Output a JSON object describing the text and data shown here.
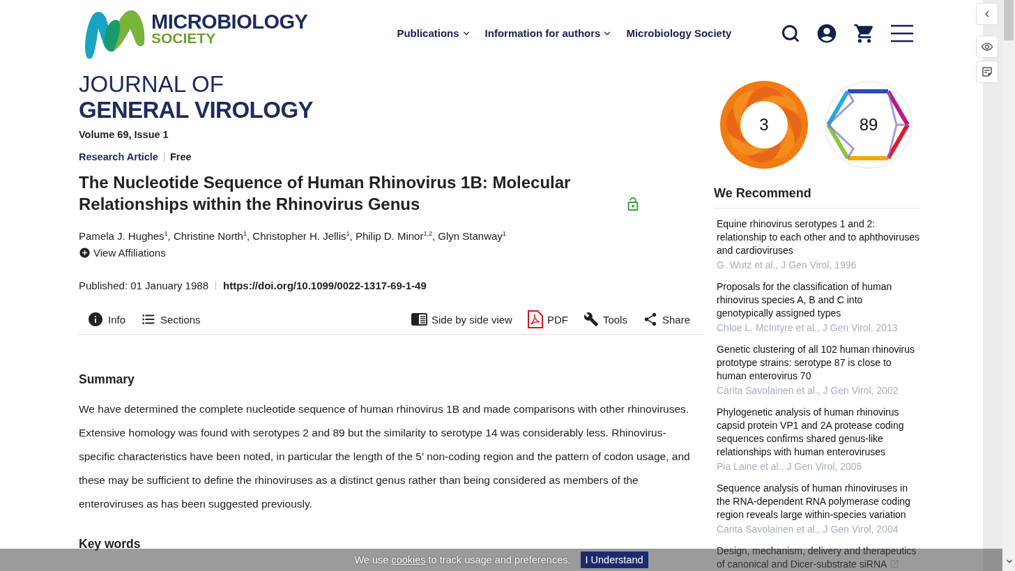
{
  "logo": {
    "line1": "MICROBIOLOGY",
    "line2": "SOCIETY"
  },
  "nav": [
    {
      "label": "Publications",
      "dropdown": true
    },
    {
      "label": "Information for authors",
      "dropdown": true
    },
    {
      "label": "Microbiology Society"
    }
  ],
  "journal": {
    "line1": "JOURNAL OF",
    "line2": "GENERAL VIROLOGY"
  },
  "issue": "Volume 69, Issue 1",
  "article_type": "Research Article",
  "access": "Free",
  "title": "The Nucleotide Sequence of Human Rhinovirus 1B: Molecular Relationships within the Rhinovirus Genus",
  "open_access": true,
  "authors": "Pamela J. Hughes$^{1}$, Christine North$^{1}$, Christopher H. Jellis$^{1}$, Philip D. Minor$^{1,2}$, Glyn Stanway$^{1}$",
  "view_affiliations": "View Affiliations",
  "published": "Published: 01 January 1988",
  "doi": "https://doi.org/10.1099/0022-1317-69-1-49",
  "toolbar_left": [
    {
      "kind": "info",
      "label": "Info"
    },
    {
      "kind": "sections",
      "label": "Sections"
    }
  ],
  "toolbar_right": [
    {
      "kind": "sidebyside",
      "label": "Side by side view"
    },
    {
      "kind": "pdf",
      "label": "PDF"
    },
    {
      "kind": "tools",
      "label": "Tools"
    },
    {
      "kind": "share",
      "label": "Share"
    }
  ],
  "summary": {
    "heading": "Summary",
    "text": "We have determined the complete nucleotide sequence of human rhinovirus 1B and made comparisons with other rhinoviruses. Extensive homology was found with serotypes 2 and 89 but the similarity to serotype 14 was considerably less. Rhinovirus-specific characteristics have been noted, in particular the length of the 5′ non-coding region and the pattern of codon usage, and these may be sufficient to define the rhinoviruses as a distinct genus rather than being considered as members of the enteroviruses as has been suggested previously."
  },
  "keywords": {
    "heading": "Key words"
  },
  "metrics": [
    {
      "kind": "altmetric",
      "value": "3"
    },
    {
      "kind": "dimensions",
      "value": "89"
    }
  ],
  "recommend": {
    "heading": "We Recommend",
    "items": [
      {
        "title": "Equine rhinovirus serotypes 1 and 2: relationship to each other and to aphthoviruses and cardioviruses",
        "meta": "G. Wutz et al., J Gen Virol, 1996"
      },
      {
        "title": "Proposals for the classification of human rhinovirus species A, B and C into genotypically assigned types",
        "meta": "Chloe L. McIntyre et al., J Gen Virol, 2013"
      },
      {
        "title": "Genetic clustering of all 102 human rhinovirus prototype strains: serotype 87 is close to human enterovirus 70",
        "meta": "Carita Savolainen et al., J Gen Virol, 2002"
      },
      {
        "title": "Phylogenetic analysis of human rhinovirus capsid protein VP1 and 2A protease coding sequences confirms shared genus-like relationships with human enteroviruses",
        "meta": "Pia Laine et al., J Gen Virol, 2005"
      },
      {
        "title": "Sequence analysis of human rhinoviruses in the RNA-dependent RNA polymerase coding region reveals large within-species variation",
        "meta": "Carita Savolainen et al., J Gen Virol, 2004"
      },
      {
        "title": "Design, mechanism, delivery and therapeutics of canonical and Dicer-substrate siRNA",
        "external": true
      }
    ]
  },
  "cookie": {
    "before": "We use ",
    "link": "cookies",
    "after": " to track usage and preferences.",
    "button": "I Understand"
  }
}
